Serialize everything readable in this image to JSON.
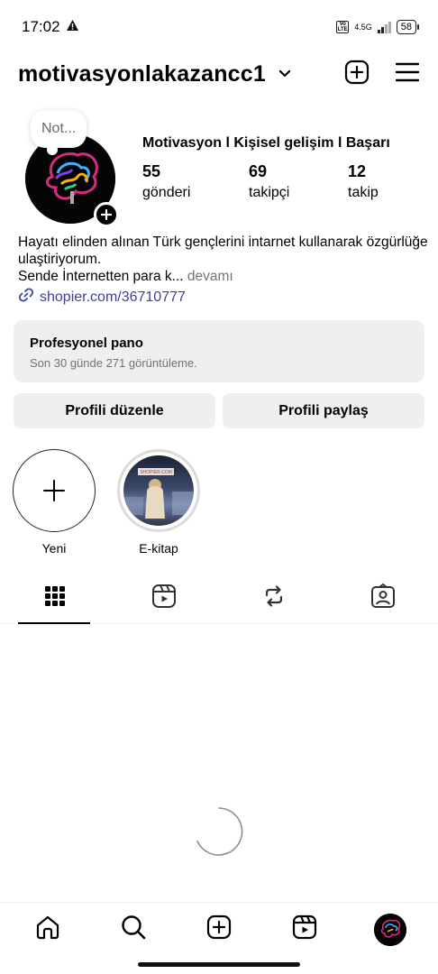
{
  "status_bar": {
    "time": "17:02",
    "alert_icon": "warning-icon",
    "volte": "Vo LTE",
    "network": "4.5G",
    "battery": "58"
  },
  "header": {
    "username": "motivasyonlakazancc1",
    "icons": [
      "chevron-down-icon",
      "create-post-icon",
      "menu-icon"
    ]
  },
  "profile": {
    "note": "Not...",
    "display_name": "Motivasyon l Kişisel gelişim l Başarı",
    "stats": [
      {
        "count": "55",
        "label": "gönderi"
      },
      {
        "count": "69",
        "label": "takipçi"
      },
      {
        "count": "12",
        "label": "takip"
      }
    ]
  },
  "bio": {
    "line1": "Hayatı elinden alınan Türk gençlerini intarnet kullanarak özgürlüğe ulaştiriyorum.",
    "line2": "Sende İnternetten para k...",
    "more": " devamı",
    "link": "shopier.com/36710777"
  },
  "dashboard": {
    "title": "Profesyonel pano",
    "subtitle": "Son 30 günde 271 görüntüleme."
  },
  "buttons": {
    "edit": "Profili düzenle",
    "share": "Profili paylaş"
  },
  "highlights": [
    {
      "label": "Yeni",
      "image_text": ""
    },
    {
      "label": "E-kitap",
      "image_text": "SHOPIER.COM"
    }
  ],
  "tabs": [
    "grid-icon",
    "reels-icon",
    "reposts-icon",
    "tagged-icon"
  ],
  "bottom_nav": [
    "home-icon",
    "search-icon",
    "create-icon",
    "reels-icon",
    "profile-avatar"
  ],
  "colors": {
    "link": "#3b3f9e",
    "secondary_text": "#737373",
    "button_bg": "#efefef"
  }
}
